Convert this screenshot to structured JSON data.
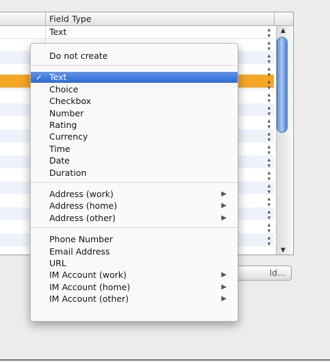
{
  "table": {
    "header_label": "Field Type",
    "first_row_value": "Text"
  },
  "background_button": {
    "label": "ld..."
  },
  "icons": {
    "stepper": "up-down-stepper-icon",
    "checkmark": "checkmark-icon",
    "submenu": "submenu-arrow-icon"
  },
  "colors": {
    "selected_row": "#f5a623",
    "menu_highlight": "#3a75dc",
    "scroll_thumb": "#6a9be0"
  },
  "menu": {
    "groups": [
      [
        {
          "label": "Do not create",
          "submenu": false,
          "selected": false
        }
      ],
      [
        {
          "label": "Text",
          "submenu": false,
          "selected": true
        },
        {
          "label": "Choice",
          "submenu": false,
          "selected": false
        },
        {
          "label": "Checkbox",
          "submenu": false,
          "selected": false
        },
        {
          "label": "Number",
          "submenu": false,
          "selected": false
        },
        {
          "label": "Rating",
          "submenu": false,
          "selected": false
        },
        {
          "label": "Currency",
          "submenu": false,
          "selected": false
        },
        {
          "label": "Time",
          "submenu": false,
          "selected": false
        },
        {
          "label": "Date",
          "submenu": false,
          "selected": false
        },
        {
          "label": "Duration",
          "submenu": false,
          "selected": false
        }
      ],
      [
        {
          "label": "Address (work)",
          "submenu": true,
          "selected": false
        },
        {
          "label": "Address (home)",
          "submenu": true,
          "selected": false
        },
        {
          "label": "Address (other)",
          "submenu": true,
          "selected": false
        }
      ],
      [
        {
          "label": "Phone Number",
          "submenu": false,
          "selected": false
        },
        {
          "label": "Email Address",
          "submenu": false,
          "selected": false
        },
        {
          "label": "URL",
          "submenu": false,
          "selected": false
        },
        {
          "label": "IM Account (work)",
          "submenu": true,
          "selected": false
        },
        {
          "label": "IM Account (home)",
          "submenu": true,
          "selected": false
        },
        {
          "label": "IM Account (other)",
          "submenu": true,
          "selected": false
        }
      ]
    ]
  }
}
